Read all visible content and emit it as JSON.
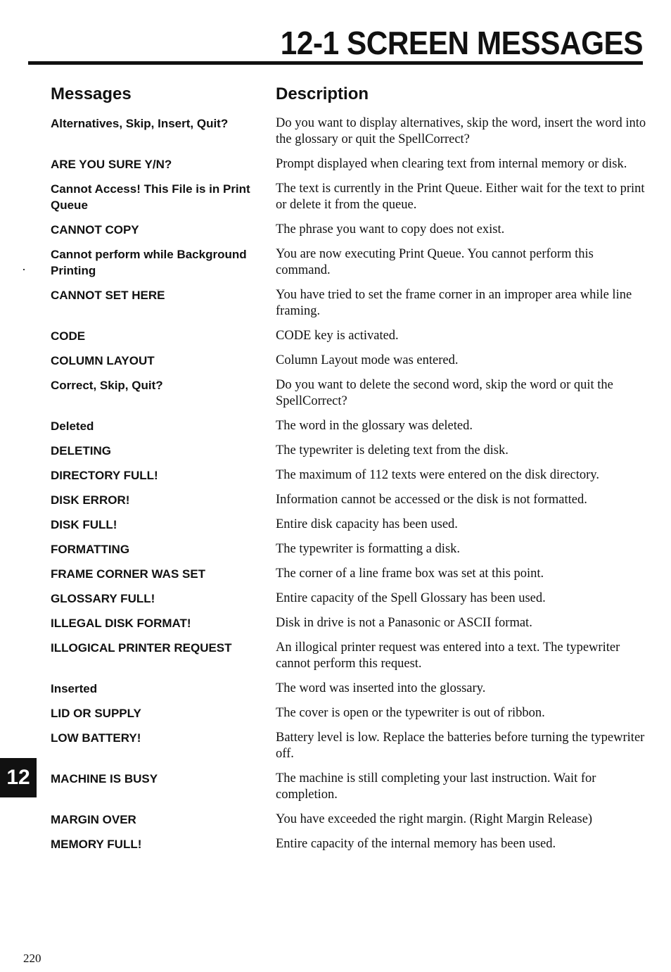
{
  "page": {
    "title": "12-1 SCREEN MESSAGES",
    "chapter_tab": "12",
    "page_number": "220"
  },
  "columns": {
    "messages_header": "Messages",
    "description_header": "Description"
  },
  "entries": [
    {
      "message": "Alternatives, Skip, Insert, Quit?",
      "description": "Do you want to display alternatives, skip the word, insert the word into the glossary or quit the SpellCorrect?"
    },
    {
      "message": "ARE YOU SURE Y/N?",
      "description": "Prompt displayed when clearing text from internal memory or disk."
    },
    {
      "message": "Cannot Access! This File is in Print Queue",
      "description": "The text is currently in the Print Queue. Either wait for the text to print or delete it from the queue."
    },
    {
      "message": "CANNOT COPY",
      "description": "The phrase you want to copy does not exist."
    },
    {
      "message": "Cannot perform while Background Printing",
      "description": "You are now executing Print Queue. You cannot perform this command."
    },
    {
      "message": "CANNOT SET HERE",
      "description": "You have tried to set the frame corner in an improper area while line framing."
    },
    {
      "message": "CODE",
      "description": "CODE key is activated."
    },
    {
      "message": "COLUMN LAYOUT",
      "description": "Column Layout mode was entered."
    },
    {
      "message": "Correct, Skip, Quit?",
      "description": "Do you want to delete the second word, skip the word or quit the SpellCorrect?"
    },
    {
      "message": "Deleted",
      "description": "The word in the glossary was deleted."
    },
    {
      "message": "DELETING",
      "description": "The typewriter is deleting text from the disk."
    },
    {
      "message": "DIRECTORY FULL!",
      "description": "The maximum of 112 texts were entered on the disk directory."
    },
    {
      "message": "DISK ERROR!",
      "description": "Information cannot be accessed or the disk is not formatted."
    },
    {
      "message": "DISK FULL!",
      "description": "Entire disk capacity has been used."
    },
    {
      "message": "FORMATTING",
      "description": "The typewriter is formatting a disk."
    },
    {
      "message": "FRAME CORNER WAS SET",
      "description": "The corner of a line frame box was set at this point."
    },
    {
      "message": "GLOSSARY FULL!",
      "description": "Entire capacity of the Spell Glossary has been used."
    },
    {
      "message": "ILLEGAL DISK FORMAT!",
      "description": "Disk in drive is not a Panasonic or ASCII format."
    },
    {
      "message": "ILLOGICAL PRINTER REQUEST",
      "description": "An illogical printer request was entered into a text. The typewriter cannot perform this request."
    },
    {
      "message": "Inserted",
      "description": "The word was inserted into the glossary."
    },
    {
      "message": "LID OR SUPPLY",
      "description": "The cover is open or the typewriter is out of ribbon."
    },
    {
      "message": "LOW BATTERY!",
      "description": "Battery level is low. Replace the batteries before turning the typewriter off."
    },
    {
      "message": "MACHINE IS BUSY",
      "description": "The machine is still completing your last instruction. Wait for completion."
    },
    {
      "message": "MARGIN OVER",
      "description": "You have exceeded the right margin. (Right Margin Release)"
    },
    {
      "message": "MEMORY FULL!",
      "description": "Entire capacity of the internal memory has been used."
    }
  ]
}
